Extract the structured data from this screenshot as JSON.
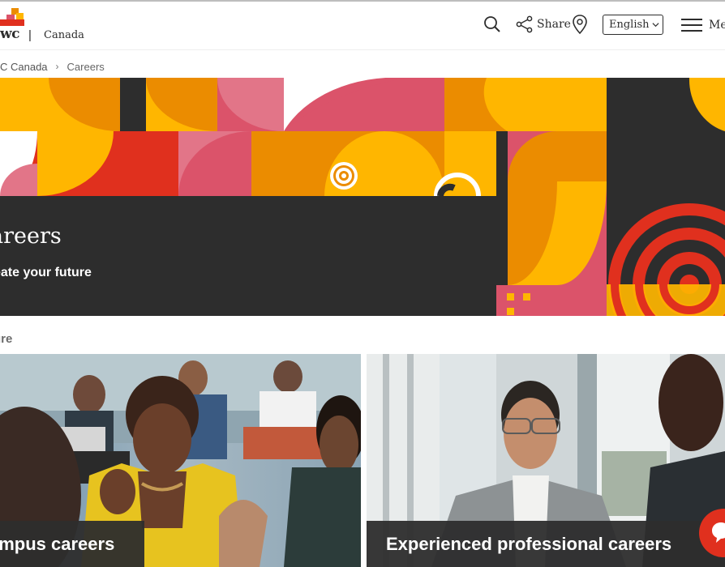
{
  "header": {
    "logo_text": "wc",
    "separator": "|",
    "region": "Canada",
    "share_label": "Share",
    "language": "English",
    "menu_label": "Menu"
  },
  "breadcrumb": {
    "items": [
      "C Canada",
      "Careers"
    ],
    "separator": "›"
  },
  "hero": {
    "title": "areers",
    "subtitle": "eate your future"
  },
  "section": {
    "label": "ure"
  },
  "cards": [
    {
      "label": "ampus careers"
    },
    {
      "label": "Experienced professional careers"
    }
  ],
  "colors": {
    "brand_dark": "#2d2d2d",
    "orange": "#eb8c00",
    "yellow": "#ffb600",
    "pink": "#db536a",
    "red": "#e0301e",
    "rose": "#e27588"
  },
  "icons": [
    "search-icon",
    "share-icon",
    "location-pin-icon",
    "chevron-down-icon",
    "hamburger-menu-icon",
    "chat-icon"
  ]
}
